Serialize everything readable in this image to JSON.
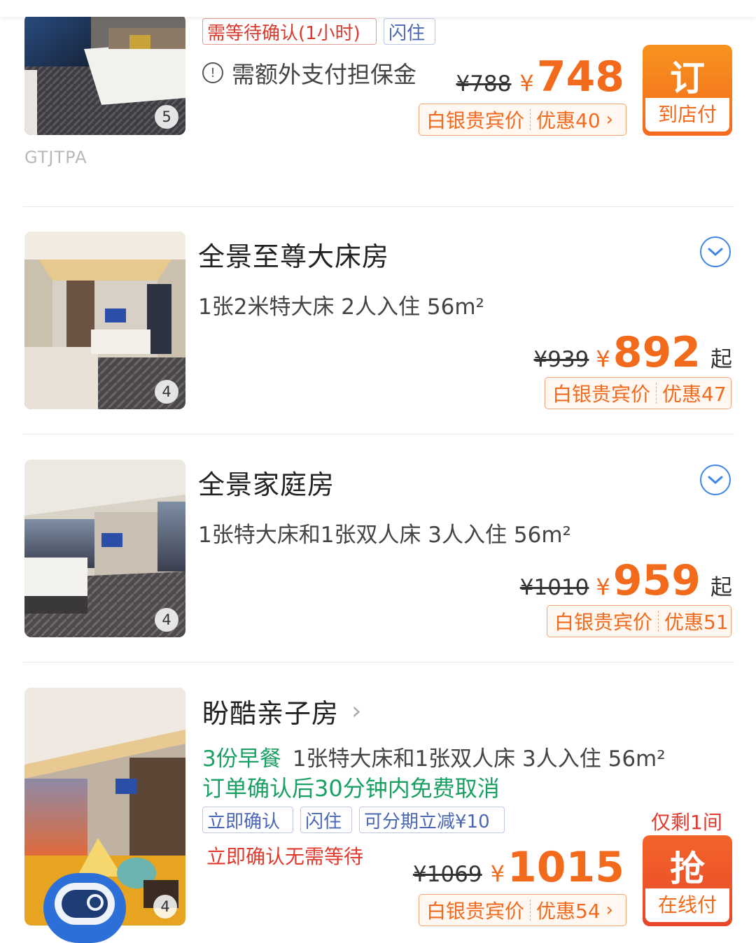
{
  "colors": {
    "accent": "#f26a1b",
    "blue": "#3f86e8",
    "green": "#1aa063",
    "red": "#e23a2e"
  },
  "room1": {
    "tag_confirm": "需等待确认(1小时)",
    "tag_flash": "闪住",
    "guarantee_text": "需额外支付担保金",
    "photo_count": "5",
    "code": "GTJTPA",
    "orig_price": "¥788",
    "yen": "¥",
    "price": "748",
    "member_label": "白银贵宾价",
    "member_discount": "优惠40",
    "book_big": "订",
    "book_small": "到店付"
  },
  "room2": {
    "title": "全景至尊大床房",
    "info": "1张2米特大床 2人入住 56m²",
    "photo_count": "4",
    "orig_price": "¥939",
    "yen": "¥",
    "price": "892",
    "suffix": "起",
    "member_label": "白银贵宾价",
    "member_discount": "优惠47"
  },
  "room3": {
    "title": "全景家庭房",
    "info": "1张特大床和1张双人床 3人入住 56m²",
    "photo_count": "4",
    "orig_price": "¥1010",
    "yen": "¥",
    "price": "959",
    "suffix": "起",
    "member_label": "白银贵宾价",
    "member_discount": "优惠51"
  },
  "room4": {
    "title": "盼酷亲子房",
    "breakfast": "3份早餐",
    "info": "1张特大床和1张双人床 3人入住 56m²",
    "cancel": "订单确认后30分钟内免费取消",
    "tag_confirm": "立即确认",
    "tag_flash": "闪住",
    "tag_installment": "可分期立减¥10",
    "no_wait": "立即确认无需等待",
    "photo_count": "4",
    "remaining": "仅剩1间",
    "orig_price": "¥1069",
    "yen": "¥",
    "price": "1015",
    "member_label": "白银贵宾价",
    "member_discount": "优惠54",
    "book_big": "抢",
    "book_small": "在线付"
  }
}
